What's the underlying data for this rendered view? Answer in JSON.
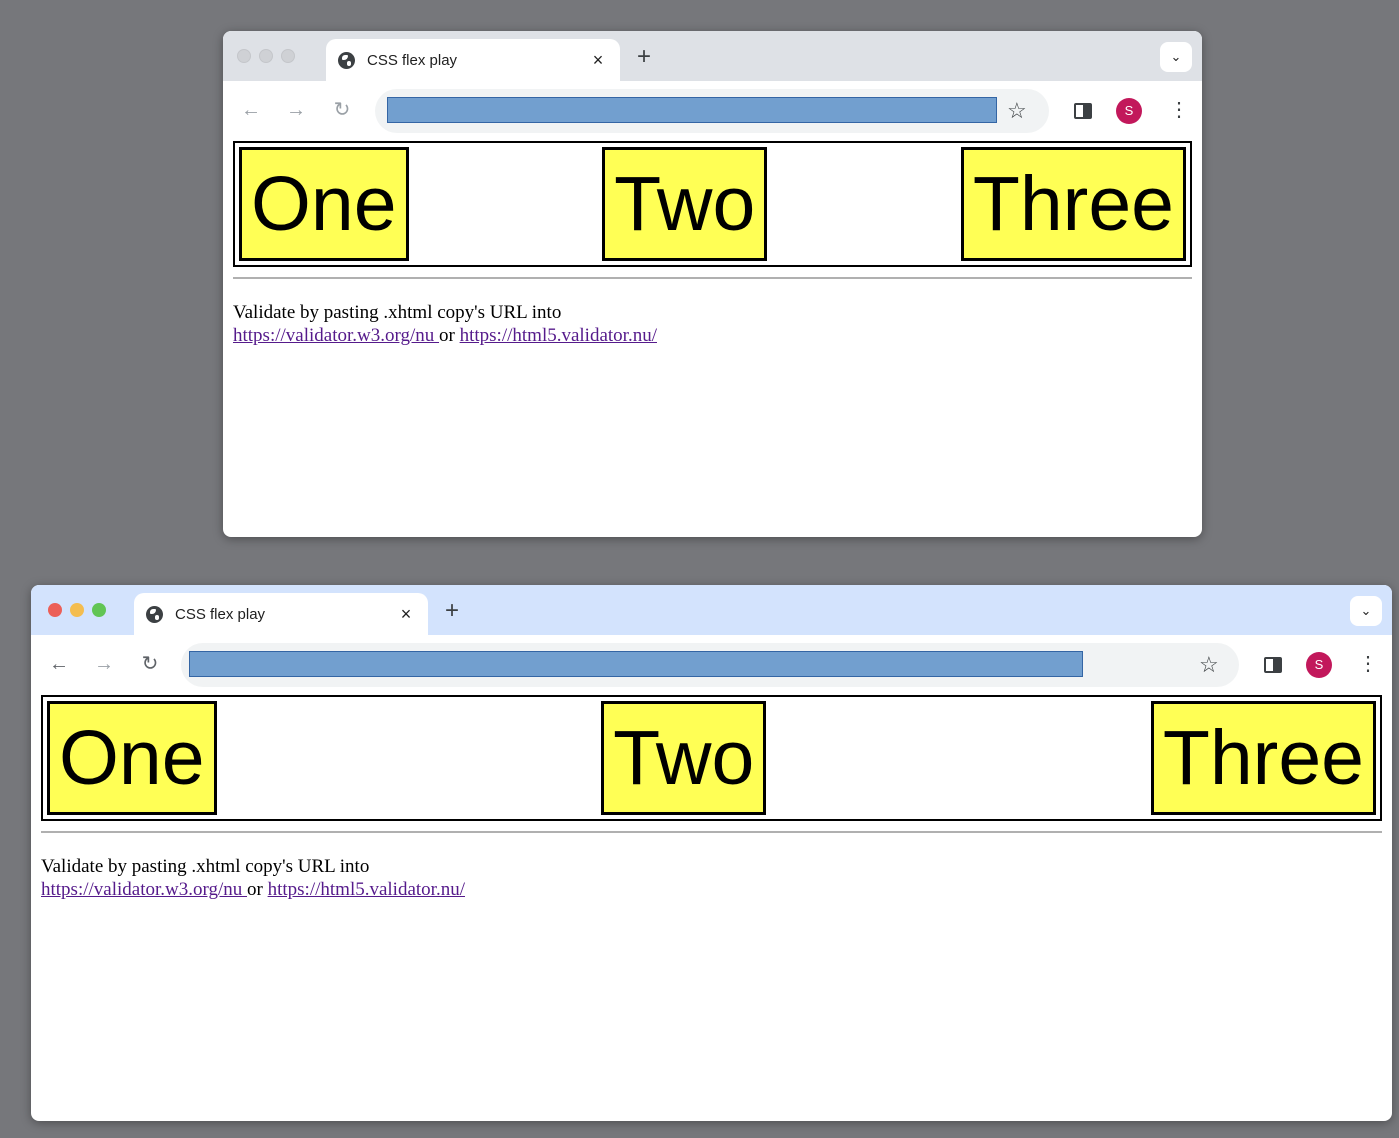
{
  "windows": [
    {
      "tab": {
        "title": "CSS flex play",
        "close": "×"
      },
      "new_tab": "+",
      "tab_search": "⌄",
      "nav": {
        "back": "←",
        "forward": "→",
        "reload": "↻"
      },
      "bookmark": "☆",
      "profile_initial": "S",
      "menu": "⋮",
      "flex_items": [
        "One",
        "Two",
        "Three"
      ],
      "note": {
        "text": "Validate by pasting .xhtml copy's URL into",
        "link1": "https://validator.w3.org/nu ",
        "or": " or ",
        "link2": "https://html5.validator.nu/"
      }
    },
    {
      "tab": {
        "title": "CSS flex play",
        "close": "×"
      },
      "new_tab": "+",
      "tab_search": "⌄",
      "nav": {
        "back": "←",
        "forward": "→",
        "reload": "↻"
      },
      "bookmark": "☆",
      "profile_initial": "S",
      "menu": "⋮",
      "flex_items": [
        "One",
        "Two",
        "Three"
      ],
      "note": {
        "text": "Validate by pasting .xhtml copy's URL into",
        "link1": "https://validator.w3.org/nu ",
        "or": " or ",
        "link2": "https://html5.validator.nu/"
      }
    }
  ],
  "colors": {
    "desktop": "#76777b",
    "item_fill": "#ffff55",
    "url_highlight": "#729fcf",
    "avatar": "#c2185b",
    "link": "#551a8b"
  }
}
